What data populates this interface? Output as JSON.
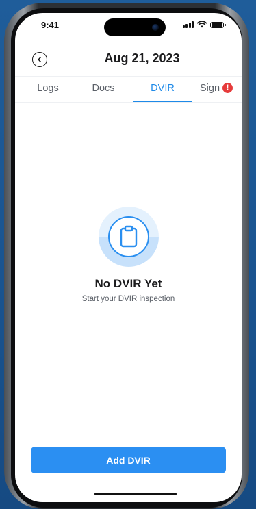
{
  "status_bar": {
    "time": "9:41",
    "icons": [
      "signal-icon",
      "wifi-icon",
      "battery-icon"
    ]
  },
  "header": {
    "back_icon": "chevron-left-icon",
    "title": "Aug 21, 2023"
  },
  "tabs": [
    {
      "label": "Logs",
      "active": false
    },
    {
      "label": "Docs",
      "active": false
    },
    {
      "label": "DVIR",
      "active": true
    },
    {
      "label": "Sign",
      "active": false,
      "badge": "!"
    }
  ],
  "empty_state": {
    "icon": "clipboard-icon",
    "title": "No DVIR Yet",
    "subtitle": "Start your DVIR inspection"
  },
  "actions": {
    "primary_label": "Add DVIR"
  },
  "colors": {
    "accent": "#2b8ff2",
    "alert": "#e63b3b",
    "background": "#1a5490"
  }
}
